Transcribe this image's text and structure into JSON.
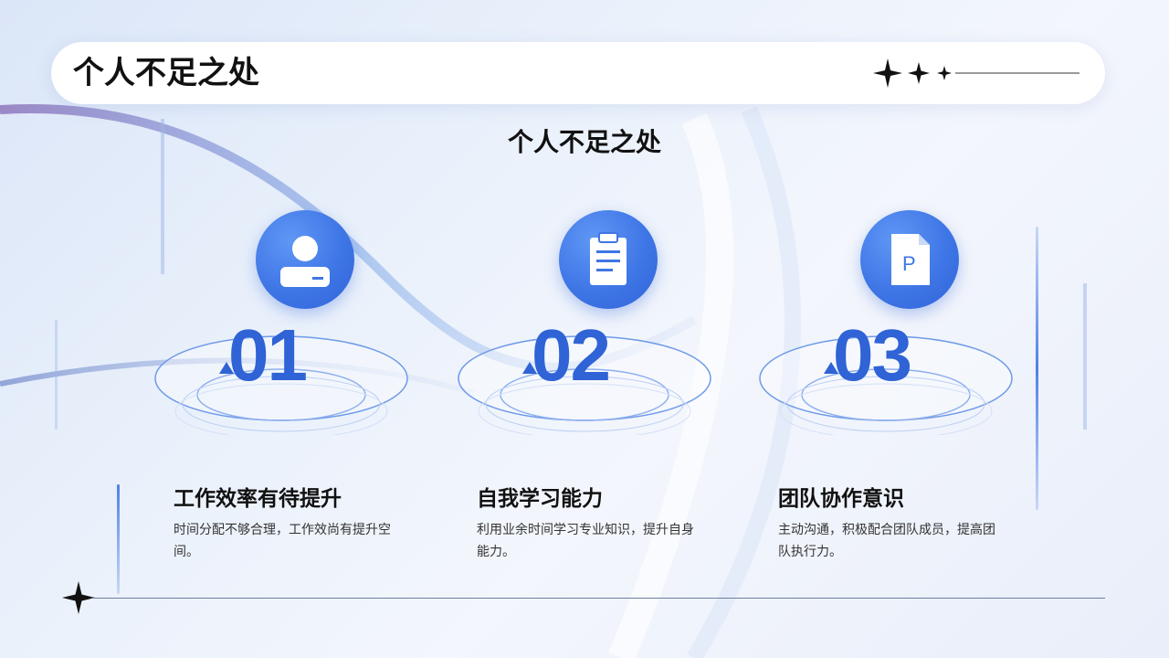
{
  "header": {
    "title": "个人不足之处"
  },
  "section": {
    "title": "个人不足之处"
  },
  "colors": {
    "accent": "#2f63d6",
    "badge": "#3f76e6",
    "text": "#111111"
  },
  "cards": [
    {
      "number": "01",
      "icon": "user-icon",
      "title": "工作效率有待提升",
      "desc": "时间分配不够合理，工作效尚有提升空间。"
    },
    {
      "number": "02",
      "icon": "clipboard-icon",
      "title": "自我学习能力",
      "desc": "利用业余时间学习专业知识，提升自身能力。"
    },
    {
      "number": "03",
      "icon": "document-p-icon",
      "title": "团队协作意识",
      "desc": "主动沟通，积极配合团队成员，提高团队执行力。"
    }
  ]
}
